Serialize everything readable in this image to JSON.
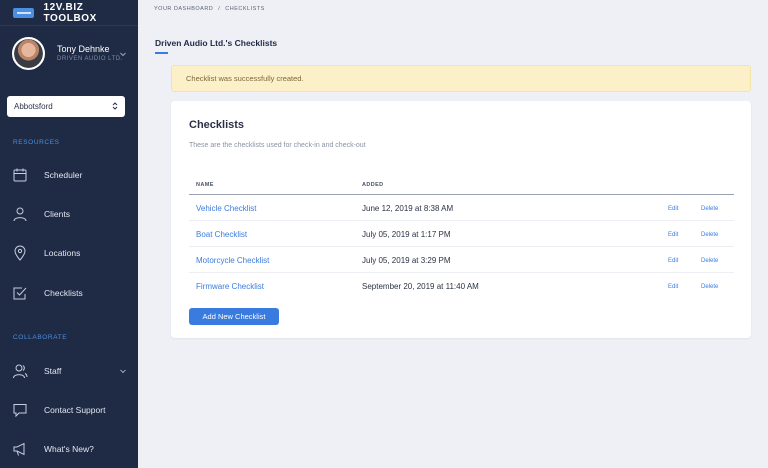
{
  "app": {
    "brand": "12V.BIZ TOOLBOX"
  },
  "user": {
    "name": "Tony Dehnke",
    "company": "DRIVEN AUDIO LTD."
  },
  "location_select": {
    "value": "Abbotsford"
  },
  "sidebar": {
    "resources_label": "RESOURCES",
    "collaborate_label": "COLLABORATE",
    "items": [
      {
        "label": "Scheduler",
        "icon": "calendar-icon"
      },
      {
        "label": "Clients",
        "icon": "user-icon"
      },
      {
        "label": "Locations",
        "icon": "map-pin-icon"
      },
      {
        "label": "Checklists",
        "icon": "checklist-icon"
      },
      {
        "label": "Staff",
        "icon": "users-icon"
      },
      {
        "label": "Contact Support",
        "icon": "chat-bubble-icon"
      },
      {
        "label": "What's New?",
        "icon": "megaphone-icon"
      }
    ]
  },
  "breadcrumb": {
    "home": "YOUR DASHBOARD",
    "separator": "/",
    "current": "CHECKLISTS"
  },
  "page": {
    "title": "Driven Audio Ltd.'s Checklists"
  },
  "alert": {
    "message": "Checklist was successfully created."
  },
  "card": {
    "title": "Checklists",
    "description": "These are the checklists used for check-in and check-out",
    "columns": {
      "name": "NAME",
      "added": "ADDED"
    },
    "rows": [
      {
        "name": "Vehicle Checklist",
        "added": "June 12, 2019 at 8:38 AM",
        "edit": "Edit",
        "delete": "Delete"
      },
      {
        "name": "Boat Checklist",
        "added": "July 05, 2019 at 1:17 PM",
        "edit": "Edit",
        "delete": "Delete"
      },
      {
        "name": "Motorcycle Checklist",
        "added": "July 05, 2019 at 3:29 PM",
        "edit": "Edit",
        "delete": "Delete"
      },
      {
        "name": "Firmware Checklist",
        "added": "September 20, 2019 at 11:40 AM",
        "edit": "Edit",
        "delete": "Delete"
      }
    ],
    "add_button": "Add New Checklist"
  },
  "colors": {
    "sidebar": "#1f2a44",
    "accent": "#3a7be0",
    "alert_bg": "#fbf0c7",
    "page_bg": "#eef0f6"
  }
}
